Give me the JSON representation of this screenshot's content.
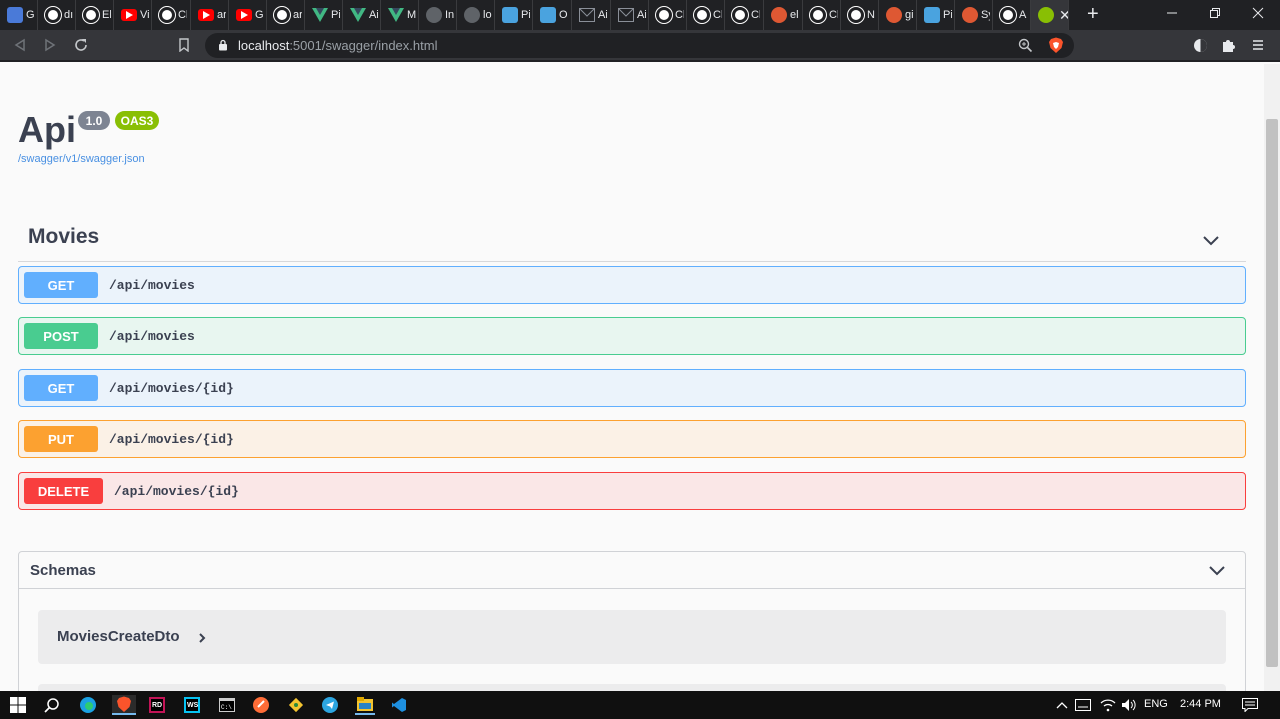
{
  "browser": {
    "tabs": [
      {
        "label": "G",
        "icon": "google-translate-icon",
        "color": "#4a7ad8"
      },
      {
        "label": "dı",
        "icon": "github-icon",
        "color": "#202124"
      },
      {
        "label": "El",
        "icon": "github-icon",
        "color": "#202124"
      },
      {
        "label": "Vi",
        "icon": "youtube-icon",
        "color": "#ff0000"
      },
      {
        "label": "Cl",
        "icon": "github-icon",
        "color": "#202124"
      },
      {
        "label": "ar",
        "icon": "youtube-icon",
        "color": "#ff0000"
      },
      {
        "label": "G",
        "icon": "youtube-icon",
        "color": "#ff0000"
      },
      {
        "label": "ar",
        "icon": "github-icon",
        "color": "#202124"
      },
      {
        "label": "Pi",
        "icon": "vue-icon",
        "color": "#41b883"
      },
      {
        "label": "Ai",
        "icon": "vue-icon",
        "color": "#41b883"
      },
      {
        "label": "M",
        "icon": "vue-devtools-icon",
        "color": "#41b883"
      },
      {
        "label": "In",
        "icon": "globe-icon",
        "color": "#5f6368"
      },
      {
        "label": "lo",
        "icon": "globe-icon",
        "color": "#5f6368"
      },
      {
        "label": "Pi",
        "icon": "swagger-icon",
        "color": "#4aa3df"
      },
      {
        "label": "O",
        "icon": "swagger-icon",
        "color": "#4aa3df"
      },
      {
        "label": "Ai",
        "icon": "mail-icon",
        "color": "#4a5060"
      },
      {
        "label": "Ai",
        "icon": "mail-icon",
        "color": "#4a5060"
      },
      {
        "label": "Cl",
        "icon": "github-icon",
        "color": "#202124"
      },
      {
        "label": "Cl",
        "icon": "github-icon",
        "color": "#202124"
      },
      {
        "label": "Cl",
        "icon": "github-icon",
        "color": "#202124"
      },
      {
        "label": "el",
        "icon": "duckduckgo-icon",
        "color": "#de5833"
      },
      {
        "label": "Cl",
        "icon": "github-icon",
        "color": "#202124"
      },
      {
        "label": "N",
        "icon": "github-icon",
        "color": "#202124"
      },
      {
        "label": "gi",
        "icon": "duckduckgo-icon",
        "color": "#de5833"
      },
      {
        "label": "Pi",
        "icon": "swagger-icon",
        "color": "#4aa3df"
      },
      {
        "label": "Sy",
        "icon": "duckduckgo-icon",
        "color": "#de5833"
      },
      {
        "label": "A",
        "icon": "github-icon",
        "color": "#202124"
      }
    ],
    "active_tab_close": "✕",
    "new_tab": "+",
    "url_host": "localhost",
    "url_path": ":5001/swagger/index.html"
  },
  "api": {
    "title": "Api",
    "version": "1.0",
    "oas": "OAS3",
    "spec_link": "/swagger/v1/swagger.json"
  },
  "tag": {
    "name": "Movies"
  },
  "operations": [
    {
      "method": "GET",
      "path": "/api/movies"
    },
    {
      "method": "POST",
      "path": "/api/movies"
    },
    {
      "method": "GET",
      "path": "/api/movies/{id}"
    },
    {
      "method": "PUT",
      "path": "/api/movies/{id}"
    },
    {
      "method": "DELETE",
      "path": "/api/movies/{id}"
    }
  ],
  "schemas": {
    "title": "Schemas",
    "models": [
      "MoviesCreateDto"
    ]
  },
  "taskbar": {
    "language": "ENG",
    "time": "2:44 PM"
  },
  "colors": {
    "get": "#61affe",
    "post": "#49cc90",
    "put": "#fca130",
    "delete": "#f93e3e",
    "oas_badge": "#89bf04",
    "version_badge": "#7d8492"
  }
}
